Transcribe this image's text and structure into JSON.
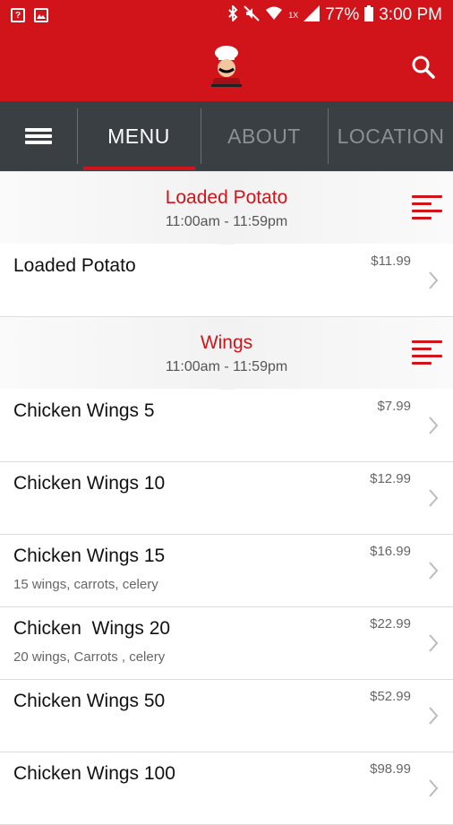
{
  "status_bar": {
    "battery": "77%",
    "time": "3:00 PM",
    "network": "1X"
  },
  "colors": {
    "brand_red": "#d0141a",
    "tab_bar": "#3a3f43",
    "tab_inactive": "#8b9095"
  },
  "header": {
    "logo_icon": "chef-logo-icon",
    "search_icon": "search-icon"
  },
  "tabs": [
    {
      "label": "MENU",
      "active": true
    },
    {
      "label": "ABOUT",
      "active": false
    },
    {
      "label": "LOCATION",
      "active": false
    }
  ],
  "sections": [
    {
      "title": "Loaded Potato",
      "hours": "11:00am - 11:59pm",
      "items": [
        {
          "name": "Loaded Potato",
          "description": "",
          "price": "$11.99"
        }
      ]
    },
    {
      "title": "Wings",
      "hours": "11:00am - 11:59pm",
      "items": [
        {
          "name": "Chicken Wings 5",
          "description": "",
          "price": "$7.99"
        },
        {
          "name": "Chicken Wings 10",
          "description": "",
          "price": "$12.99"
        },
        {
          "name": "Chicken Wings 15",
          "description": "15 wings, carrots, celery",
          "price": "$16.99"
        },
        {
          "name": "Chicken  Wings 20",
          "description": "20 wings, Carrots , celery",
          "price": "$22.99"
        },
        {
          "name": "Chicken Wings 50",
          "description": "",
          "price": "$52.99"
        },
        {
          "name": "Chicken Wings 100",
          "description": "",
          "price": "$98.99"
        }
      ]
    }
  ]
}
